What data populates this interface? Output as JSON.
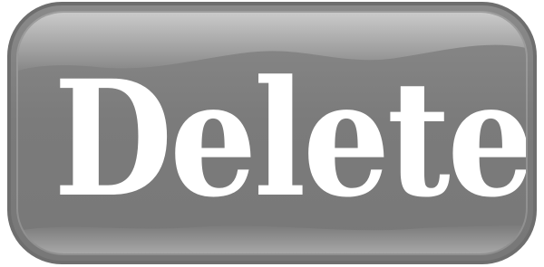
{
  "button": {
    "label": "Delete"
  },
  "colors": {
    "background": "#ffffff",
    "button_fill": "#7b7b7b",
    "button_border": "#6e6e6e",
    "label": "#ffffff"
  }
}
